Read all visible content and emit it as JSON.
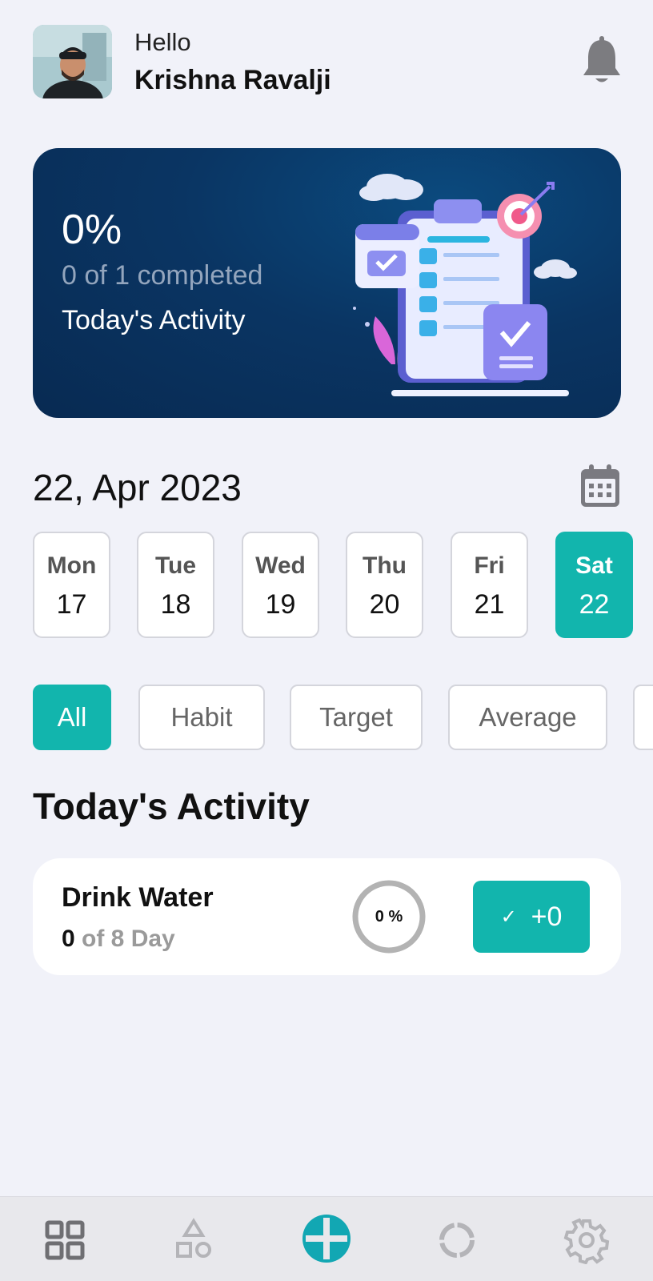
{
  "user": {
    "greeting": "Hello",
    "name": "Krishna Ravalji"
  },
  "summary": {
    "percent": "0%",
    "completed": "0 of 1 completed",
    "label": "Today's Activity"
  },
  "date": {
    "title": "22, Apr 2023"
  },
  "days": [
    {
      "name": "Mon",
      "num": "17",
      "active": false
    },
    {
      "name": "Tue",
      "num": "18",
      "active": false
    },
    {
      "name": "Wed",
      "num": "19",
      "active": false
    },
    {
      "name": "Thu",
      "num": "20",
      "active": false
    },
    {
      "name": "Fri",
      "num": "21",
      "active": false
    },
    {
      "name": "Sat",
      "num": "22",
      "active": true
    }
  ],
  "filters": [
    {
      "label": "All",
      "active": true
    },
    {
      "label": "Habit",
      "active": false
    },
    {
      "label": "Target",
      "active": false
    },
    {
      "label": "Average",
      "active": false
    },
    {
      "label": "",
      "active": false
    }
  ],
  "section": {
    "title": "Today's Activity"
  },
  "activities": [
    {
      "title": "Drink Water",
      "count": "0",
      "of_text": "of 8 Day",
      "ring_label": "0 %",
      "progress": 0,
      "button_label": "+0"
    }
  ],
  "nav": [
    {
      "icon": "grid-icon",
      "active": false
    },
    {
      "icon": "shapes-icon",
      "active": false
    },
    {
      "icon": "add-circle-icon",
      "active": true
    },
    {
      "icon": "progress-ring-icon",
      "active": false
    },
    {
      "icon": "settings-gear-icon",
      "active": false
    }
  ],
  "colors": {
    "accent": "#12b5ad",
    "banner": "#0a3563",
    "background": "#f1f2f9"
  }
}
